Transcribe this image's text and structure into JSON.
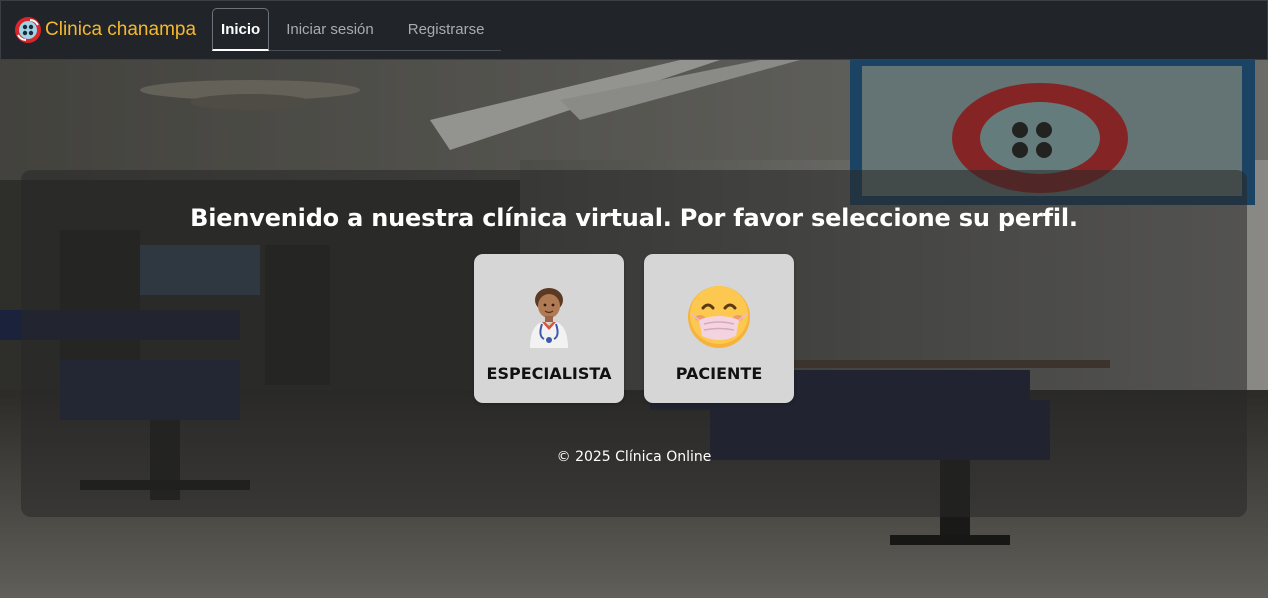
{
  "brand": {
    "name": "Clinica chanampa",
    "logo_icon": "clinic-logo-icon",
    "color": "#f5b82e"
  },
  "nav": {
    "tabs": [
      {
        "label": "Inicio",
        "active": true
      },
      {
        "label": "Iniciar sesión",
        "active": false
      },
      {
        "label": "Registrarse",
        "active": false
      }
    ]
  },
  "main": {
    "welcome_text": "Bienvenido a nuestra clínica virtual. Por favor seleccione su perfil.",
    "profiles": [
      {
        "label": "ESPECIALISTA",
        "icon": "doctor-icon"
      },
      {
        "label": "PACIENTE",
        "icon": "masked-face-icon"
      }
    ],
    "footer": "© 2025 Clínica Online"
  },
  "colors": {
    "navbar_bg": "#212529",
    "card_bg": "#d6d6d6",
    "brand_accent": "#f5b82e"
  }
}
